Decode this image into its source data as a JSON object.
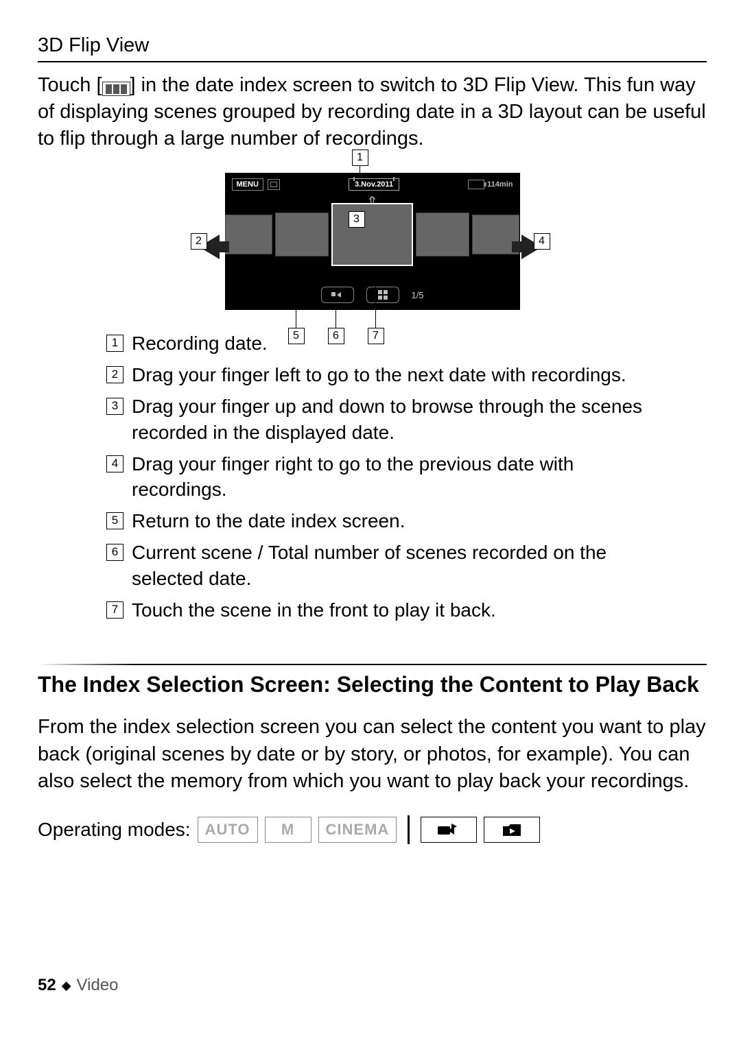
{
  "section1": {
    "heading": "3D Flip View",
    "intro_before": "Touch [",
    "intro_after": "] in the date index screen to switch to 3D Flip View. This fun way of displaying scenes grouped by recording date in a 3D layout can be useful to flip through a large number of recordings."
  },
  "diagram": {
    "menu_label": "MENU",
    "date": "3.Nov.2011",
    "battery_time": "114min",
    "counter": "1/5",
    "callouts": {
      "c1": "1",
      "c2": "2",
      "c3": "3",
      "c4": "4",
      "c5": "5",
      "c6": "6",
      "c7": "7"
    }
  },
  "legend": [
    {
      "n": "1",
      "text": "Recording date."
    },
    {
      "n": "2",
      "text": "Drag your finger left to go to the next date with recordings."
    },
    {
      "n": "3",
      "text": "Drag your finger up and down to browse through the scenes recorded in the displayed date."
    },
    {
      "n": "4",
      "text": "Drag your finger right to go to the previous date with recordings."
    },
    {
      "n": "5",
      "text": "Return to the date index screen."
    },
    {
      "n": "6",
      "text": "Current scene / Total number of scenes recorded on the selected date."
    },
    {
      "n": "7",
      "text": "Touch the scene in the front to play it back."
    }
  ],
  "section2": {
    "heading": "The Index Selection Screen: Selecting the Content to Play Back",
    "body": "From the index selection screen you can select the content you want to play back (original scenes by date or by story, or photos, for example). You can also select the memory from which you want to play back your recordings.",
    "op_label": "Operating modes:",
    "modes": {
      "auto": "AUTO",
      "m": "M",
      "cinema": "CINEMA"
    }
  },
  "footer": {
    "page": "52",
    "chapter": "Video"
  }
}
